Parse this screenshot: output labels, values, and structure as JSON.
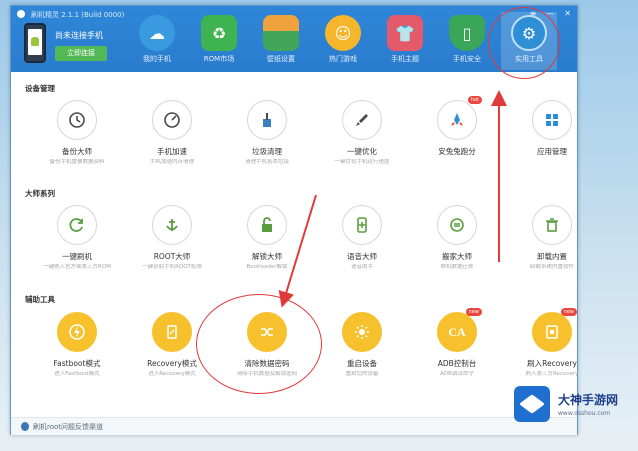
{
  "window": {
    "title": "刷机精灵 2.1.1 (Build 0000)",
    "controls": [
      "≡",
      "—",
      "✕"
    ]
  },
  "device": {
    "label": "尚未连接手机",
    "connect_label": "立即连接"
  },
  "nav": [
    {
      "label": "我的手机",
      "icon": "cloud-icon",
      "color": "#3a9ae0"
    },
    {
      "label": "ROM市场",
      "icon": "rom-bag-icon",
      "color": "#3fb34f"
    },
    {
      "label": "壁纸设置",
      "icon": "wallpaper-icon",
      "color": "#f0a33c"
    },
    {
      "label": "热门游戏",
      "icon": "game-face-icon",
      "color": "#f5b62c"
    },
    {
      "label": "手机主题",
      "icon": "theme-shirt-icon",
      "color": "#e45a6b"
    },
    {
      "label": "手机安全",
      "icon": "shield-icon",
      "color": "#3aa657"
    },
    {
      "label": "实用工具",
      "icon": "tools-icon",
      "color": "#2f8fd6"
    }
  ],
  "sections": [
    {
      "title": "设备管理",
      "tools": [
        {
          "label": "备份大师",
          "desc": "备份手机重要数据资料",
          "icon": "backup-restore-icon"
        },
        {
          "label": "手机加速",
          "desc": "手机加速内存清理",
          "icon": "speedometer-icon"
        },
        {
          "label": "垃圾清理",
          "desc": "清理手机各类垃圾",
          "icon": "broom-icon"
        },
        {
          "label": "一键优化",
          "desc": "一键优化手机运行速度",
          "icon": "rocket-icon"
        },
        {
          "label": "安兔兔跑分",
          "desc": "",
          "icon": "rocket-badge-icon",
          "badge": "hot"
        },
        {
          "label": "应用管理",
          "desc": "",
          "icon": "apps-grid-icon"
        }
      ]
    },
    {
      "title": "大师系列",
      "tools": [
        {
          "label": "一键刷机",
          "desc": "一键刷入官方或第三方ROM",
          "icon": "refresh-icon"
        },
        {
          "label": "ROOT大师",
          "desc": "一键获取手机ROOT权限",
          "icon": "anchor-icon"
        },
        {
          "label": "解锁大师",
          "desc": "Bootloader解锁",
          "icon": "unlock-icon"
        },
        {
          "label": "语音大师",
          "desc": "语音助手",
          "icon": "phone-add-icon"
        },
        {
          "label": "搬家大师",
          "desc": "换机数据迁移",
          "icon": "transfer-icon"
        },
        {
          "label": "卸载内置",
          "desc": "卸载系统内置软件",
          "icon": "trash-icon"
        }
      ]
    },
    {
      "title": "辅助工具",
      "tools": [
        {
          "label": "Fastboot模式",
          "desc": "进入Fastboot模式",
          "icon": "lightning-icon"
        },
        {
          "label": "Recovery模式",
          "desc": "进入Recovery模式",
          "icon": "recovery-icon"
        },
        {
          "label": "清除数据密码",
          "desc": "清除手机数据及解锁密码",
          "icon": "shuffle-icon"
        },
        {
          "label": "重启设备",
          "desc": "重启您的设备",
          "icon": "sun-reboot-icon"
        },
        {
          "label": "ADB控制台",
          "desc": "ADB调试命令",
          "icon": "ca-icon",
          "badge": "new"
        },
        {
          "label": "刷入Recovery",
          "desc": "刷入第三方Recovery",
          "icon": "recovery-install-icon",
          "badge": "new"
        }
      ]
    }
  ],
  "status": {
    "text": "刷机root问题反馈渠道"
  },
  "watermark": {
    "title": "大神手游网",
    "url": "www.dsshou.com"
  },
  "colors": {
    "header_blue": "#2a7ccd",
    "accent_yellow": "#f6c12d",
    "annotation_red": "#e03a3a",
    "connect_green": "#53b956"
  }
}
